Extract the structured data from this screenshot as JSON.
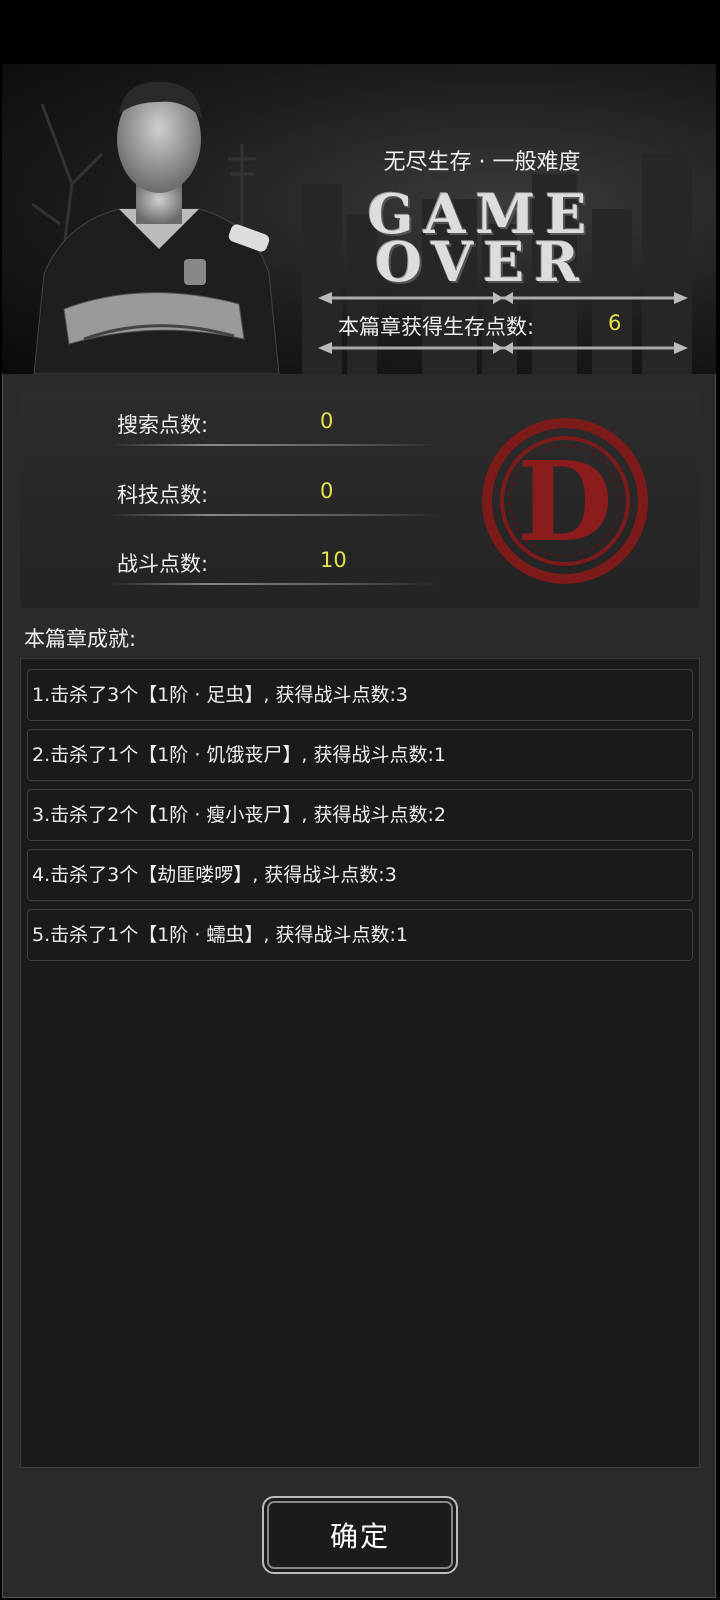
{
  "header": {
    "mode": "无尽生存 · 一般难度",
    "game_over_line1": "GAME",
    "game_over_line2": "OVER",
    "earned_label": "本篇章获得生存点数:",
    "earned_value": "6"
  },
  "stats": [
    {
      "label": "搜索点数:",
      "value": "0"
    },
    {
      "label": "科技点数:",
      "value": "0"
    },
    {
      "label": "战斗点数:",
      "value": "10"
    }
  ],
  "grade": {
    "letter": "D",
    "color": "#8b1c1c"
  },
  "achievements": {
    "title": "本篇章成就:",
    "items": [
      "1.击杀了3个【1阶 · 足虫】, 获得战斗点数:3",
      "2.击杀了1个【1阶 · 饥饿丧尸】, 获得战斗点数:1",
      "3.击杀了2个【1阶 · 瘦小丧尸】, 获得战斗点数:2",
      "4.击杀了3个【劫匪喽啰】, 获得战斗点数:3",
      "5.击杀了1个【1阶 · 蠕虫】, 获得战斗点数:1"
    ]
  },
  "confirm_label": "确定",
  "colors": {
    "value_yellow": "#e8e24a",
    "panel": "#2a2a2a"
  }
}
